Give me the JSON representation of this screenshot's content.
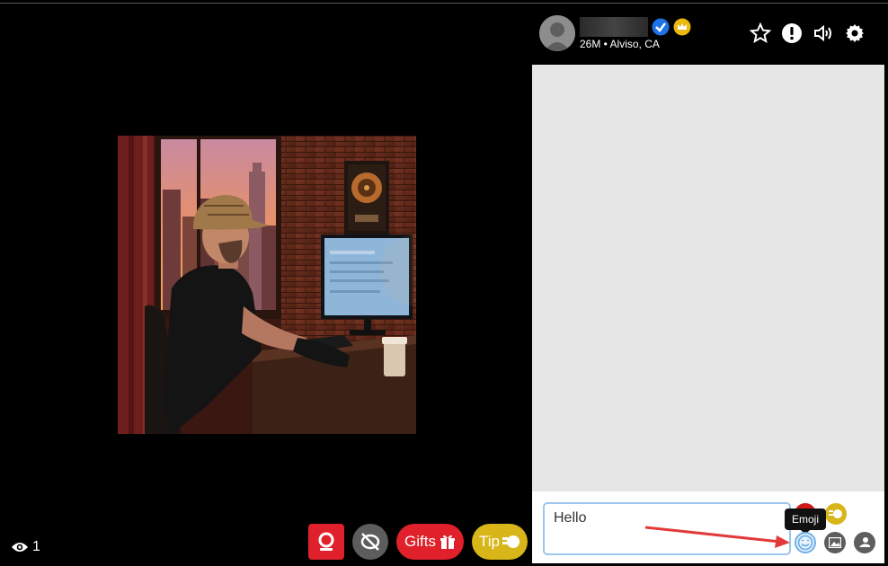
{
  "profile": {
    "subline": "26M • Alviso, CA",
    "verified_icon": "check-badge-icon",
    "crown_icon": "crown-icon"
  },
  "header_icons": [
    "star-icon",
    "report-icon",
    "volume-icon",
    "gear-icon"
  ],
  "viewers": {
    "count": "1",
    "icon": "eye-icon"
  },
  "controls": {
    "gifts_label": "Gifts",
    "tip_label": "Tip"
  },
  "chat": {
    "input_value": "Hello",
    "tooltip": "Emoji"
  },
  "colors": {
    "red": "#e0202a",
    "gold": "#d8b61a",
    "chat_bg": "#e6e6e6",
    "input_border": "#9cc6ec",
    "verified_blue": "#1d72e8"
  }
}
